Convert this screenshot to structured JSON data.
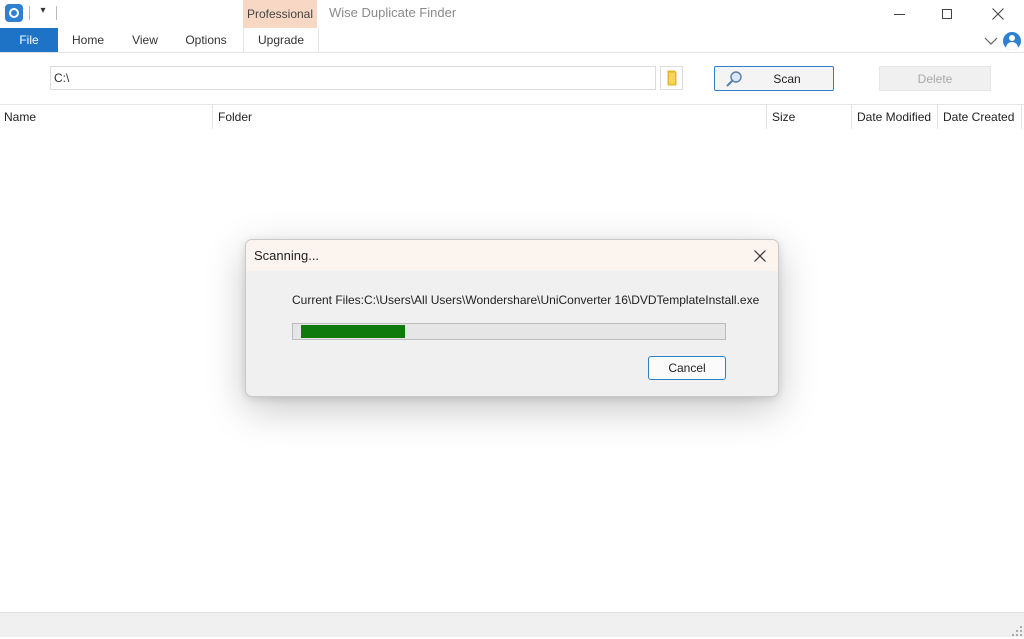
{
  "window": {
    "title": "Wise Duplicate Finder",
    "professional_badge": "Professional"
  },
  "ribbon": {
    "tabs": [
      {
        "label": "File",
        "active": true
      },
      {
        "label": "Home"
      },
      {
        "label": "View"
      },
      {
        "label": "Options"
      },
      {
        "label": "Upgrade"
      }
    ]
  },
  "toolbar": {
    "path_value": "C:\\",
    "scan_label": "Scan",
    "delete_label": "Delete"
  },
  "table": {
    "columns": [
      "Name",
      "Folder",
      "Size",
      "Date Modified",
      "Date Created"
    ],
    "rows": []
  },
  "dialog": {
    "title": "Scanning...",
    "current_file": "Current Files:C:\\Users\\All Users\\Wondershare\\UniConverter 16\\DVDTemplateInstall.exe",
    "progress": 0.25,
    "cancel_label": "Cancel"
  },
  "colors": {
    "accent": "#1e73c6",
    "professional_tab": "#f8d8c4",
    "progress_fill": "#0e7a0d",
    "focus_border": "#2f7fc6"
  },
  "icons": [
    "app-logo-icon",
    "quick-access-dropdown-icon",
    "minimize-icon",
    "maximize-icon",
    "close-icon",
    "chevron-down-icon",
    "account-icon",
    "folder-icon",
    "magnifier-icon",
    "size-grip-icon"
  ]
}
